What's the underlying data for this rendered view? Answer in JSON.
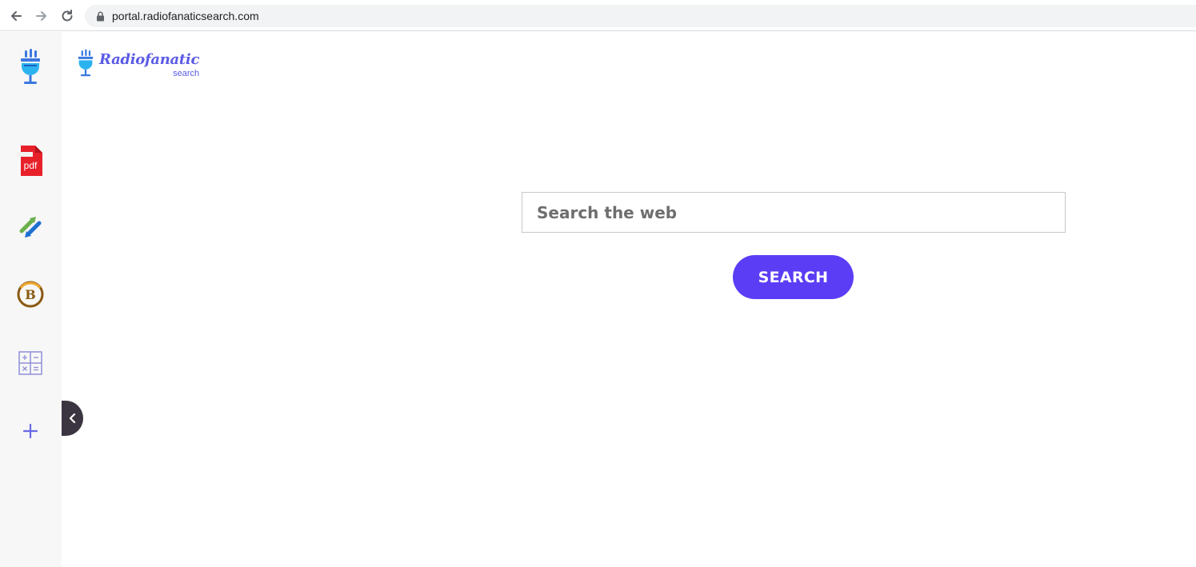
{
  "browser": {
    "url": "portal.radiofanaticsearch.com"
  },
  "logo": {
    "main": "Radiofanatic",
    "sub": "search"
  },
  "sidebar": {
    "items": [
      {
        "icon": "microphone-icon"
      },
      {
        "icon": "pdf-icon",
        "text": "pdf"
      },
      {
        "icon": "convert-arrows-icon"
      },
      {
        "icon": "bitcoin-icon",
        "text": "B"
      },
      {
        "icon": "calculator-icon"
      },
      {
        "icon": "plus-icon"
      }
    ]
  },
  "search": {
    "placeholder": "Search the web",
    "button_label": "SEARCH"
  },
  "colors": {
    "accent": "#5b3df5",
    "logo": "#5b5be6",
    "sidebar_bg": "#f7f7f7",
    "collapse_tab": "#3a3540"
  }
}
